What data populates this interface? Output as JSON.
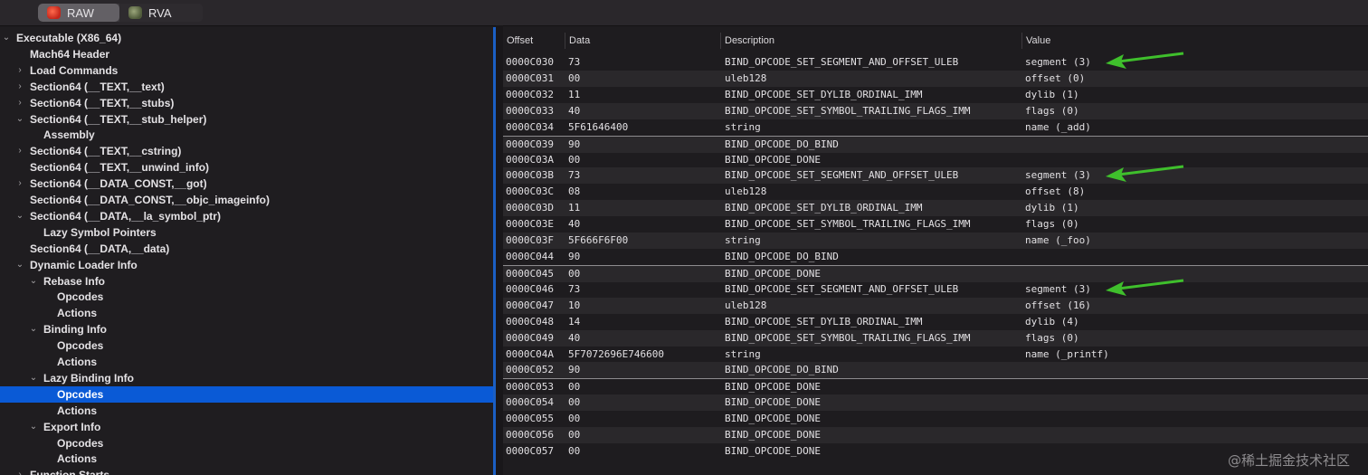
{
  "toolbar": {
    "raw_label": "RAW",
    "rva_label": "RVA",
    "raw_icon": "raw-icon",
    "rva_icon": "rva-icon"
  },
  "tree": [
    {
      "label": "Executable  (X86_64)",
      "level": 0,
      "disclosure": "open"
    },
    {
      "label": "Mach64 Header",
      "level": 1,
      "disclosure": "none"
    },
    {
      "label": "Load Commands",
      "level": 1,
      "disclosure": "closed"
    },
    {
      "label": "Section64 (__TEXT,__text)",
      "level": 1,
      "disclosure": "closed"
    },
    {
      "label": "Section64 (__TEXT,__stubs)",
      "level": 1,
      "disclosure": "closed"
    },
    {
      "label": "Section64 (__TEXT,__stub_helper)",
      "level": 1,
      "disclosure": "open"
    },
    {
      "label": "Assembly",
      "level": 2,
      "disclosure": "none"
    },
    {
      "label": "Section64 (__TEXT,__cstring)",
      "level": 1,
      "disclosure": "closed"
    },
    {
      "label": "Section64 (__TEXT,__unwind_info)",
      "level": 1,
      "disclosure": "none"
    },
    {
      "label": "Section64 (__DATA_CONST,__got)",
      "level": 1,
      "disclosure": "closed"
    },
    {
      "label": "Section64 (__DATA_CONST,__objc_imageinfo)",
      "level": 1,
      "disclosure": "none"
    },
    {
      "label": "Section64 (__DATA,__la_symbol_ptr)",
      "level": 1,
      "disclosure": "open"
    },
    {
      "label": "Lazy Symbol Pointers",
      "level": 2,
      "disclosure": "none"
    },
    {
      "label": "Section64 (__DATA,__data)",
      "level": 1,
      "disclosure": "none"
    },
    {
      "label": "Dynamic Loader Info",
      "level": 1,
      "disclosure": "open"
    },
    {
      "label": "Rebase Info",
      "level": 2,
      "disclosure": "open"
    },
    {
      "label": "Opcodes",
      "level": 3,
      "disclosure": "none"
    },
    {
      "label": "Actions",
      "level": 3,
      "disclosure": "none"
    },
    {
      "label": "Binding Info",
      "level": 2,
      "disclosure": "open"
    },
    {
      "label": "Opcodes",
      "level": 3,
      "disclosure": "none"
    },
    {
      "label": "Actions",
      "level": 3,
      "disclosure": "none"
    },
    {
      "label": "Lazy Binding Info",
      "level": 2,
      "disclosure": "open"
    },
    {
      "label": "Opcodes",
      "level": 3,
      "disclosure": "none",
      "selected": true
    },
    {
      "label": "Actions",
      "level": 3,
      "disclosure": "none"
    },
    {
      "label": "Export Info",
      "level": 2,
      "disclosure": "open"
    },
    {
      "label": "Opcodes",
      "level": 3,
      "disclosure": "none"
    },
    {
      "label": "Actions",
      "level": 3,
      "disclosure": "none"
    },
    {
      "label": "Function Starts",
      "level": 1,
      "disclosure": "closed"
    }
  ],
  "table": {
    "headers": [
      "Offset",
      "Data",
      "Description",
      "Value"
    ],
    "rows": [
      {
        "offset": "0000C030",
        "data": "73",
        "desc": "BIND_OPCODE_SET_SEGMENT_AND_OFFSET_ULEB",
        "value": "segment (3)",
        "arrow": true
      },
      {
        "offset": "0000C031",
        "data": "00",
        "desc": "uleb128",
        "value": "offset (0)"
      },
      {
        "offset": "0000C032",
        "data": "11",
        "desc": "BIND_OPCODE_SET_DYLIB_ORDINAL_IMM",
        "value": "dylib (1)"
      },
      {
        "offset": "0000C033",
        "data": "40",
        "desc": "BIND_OPCODE_SET_SYMBOL_TRAILING_FLAGS_IMM",
        "value": "flags (0)"
      },
      {
        "offset": "0000C034",
        "data": "5F61646400",
        "desc": "string",
        "value": "name (_add)"
      },
      {
        "offset": "0000C039",
        "data": "90",
        "desc": "BIND_OPCODE_DO_BIND",
        "value": "",
        "separator": true
      },
      {
        "offset": "0000C03A",
        "data": "00",
        "desc": "BIND_OPCODE_DONE",
        "value": ""
      },
      {
        "offset": "0000C03B",
        "data": "73",
        "desc": "BIND_OPCODE_SET_SEGMENT_AND_OFFSET_ULEB",
        "value": "segment (3)",
        "arrow": true
      },
      {
        "offset": "0000C03C",
        "data": "08",
        "desc": "uleb128",
        "value": "offset (8)"
      },
      {
        "offset": "0000C03D",
        "data": "11",
        "desc": "BIND_OPCODE_SET_DYLIB_ORDINAL_IMM",
        "value": "dylib (1)"
      },
      {
        "offset": "0000C03E",
        "data": "40",
        "desc": "BIND_OPCODE_SET_SYMBOL_TRAILING_FLAGS_IMM",
        "value": "flags (0)"
      },
      {
        "offset": "0000C03F",
        "data": "5F666F6F00",
        "desc": "string",
        "value": "name (_foo)"
      },
      {
        "offset": "0000C044",
        "data": "90",
        "desc": "BIND_OPCODE_DO_BIND",
        "value": ""
      },
      {
        "offset": "0000C045",
        "data": "00",
        "desc": "BIND_OPCODE_DONE",
        "value": "",
        "separator": true
      },
      {
        "offset": "0000C046",
        "data": "73",
        "desc": "BIND_OPCODE_SET_SEGMENT_AND_OFFSET_ULEB",
        "value": "segment (3)",
        "arrow": true
      },
      {
        "offset": "0000C047",
        "data": "10",
        "desc": "uleb128",
        "value": "offset (16)"
      },
      {
        "offset": "0000C048",
        "data": "14",
        "desc": "BIND_OPCODE_SET_DYLIB_ORDINAL_IMM",
        "value": "dylib (4)"
      },
      {
        "offset": "0000C049",
        "data": "40",
        "desc": "BIND_OPCODE_SET_SYMBOL_TRAILING_FLAGS_IMM",
        "value": "flags (0)"
      },
      {
        "offset": "0000C04A",
        "data": "5F7072696E746600",
        "desc": "string",
        "value": "name (_printf)"
      },
      {
        "offset": "0000C052",
        "data": "90",
        "desc": "BIND_OPCODE_DO_BIND",
        "value": ""
      },
      {
        "offset": "0000C053",
        "data": "00",
        "desc": "BIND_OPCODE_DONE",
        "value": "",
        "separator": true
      },
      {
        "offset": "0000C054",
        "data": "00",
        "desc": "BIND_OPCODE_DONE",
        "value": ""
      },
      {
        "offset": "0000C055",
        "data": "00",
        "desc": "BIND_OPCODE_DONE",
        "value": ""
      },
      {
        "offset": "0000C056",
        "data": "00",
        "desc": "BIND_OPCODE_DONE",
        "value": ""
      },
      {
        "offset": "0000C057",
        "data": "00",
        "desc": "BIND_OPCODE_DONE",
        "value": ""
      }
    ]
  },
  "watermark": "@稀土掘金技术社区",
  "colors": {
    "selection": "#0a5ad6",
    "panel_border": "#1b5fc4",
    "arrow": "#3fbf2c"
  }
}
